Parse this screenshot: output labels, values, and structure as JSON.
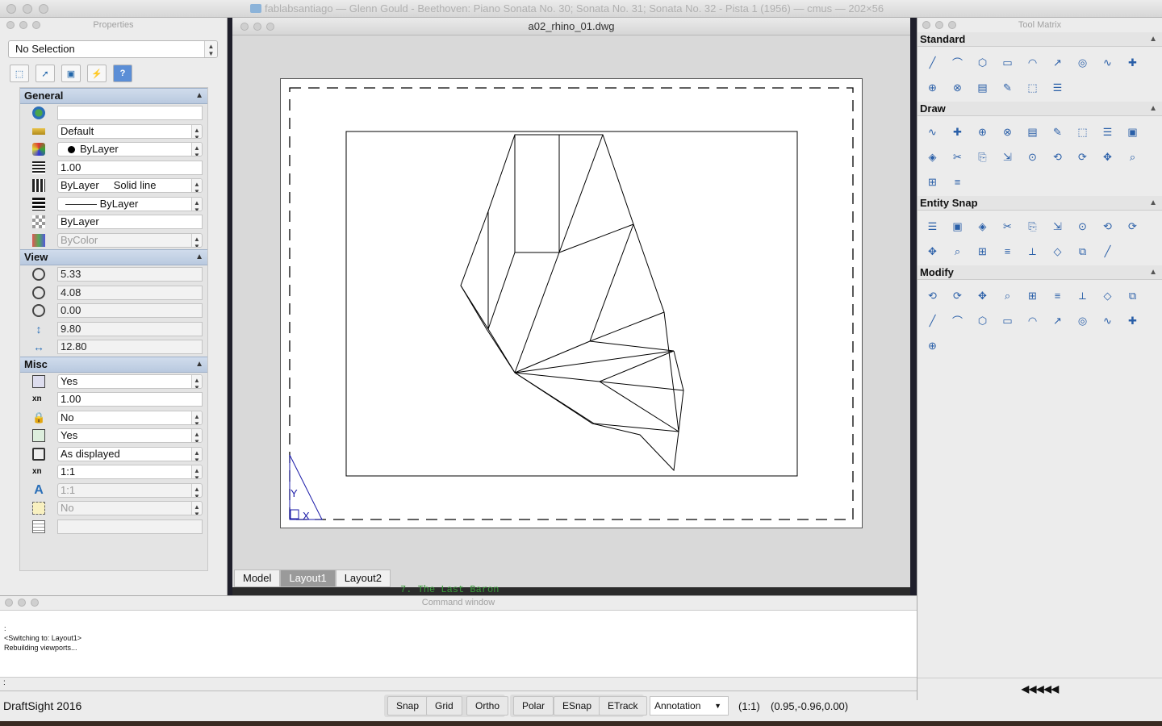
{
  "window": {
    "title": "fablabsantiago — Glenn Gould - Beethoven: Piano Sonata No. 30; Sonata No. 31; Sonata No. 32 - Pista 1 (1956) — cmus — 202×56"
  },
  "properties": {
    "panel_title": "Properties",
    "selection": "No Selection",
    "sections": {
      "general": {
        "title": "General",
        "rows": [
          {
            "icon": "globe-icon",
            "value": ""
          },
          {
            "icon": "layer-icon",
            "value": "Default"
          },
          {
            "icon": "color-icon",
            "value": "ByLayer"
          },
          {
            "icon": "linescale-icon",
            "value": "1.00"
          },
          {
            "icon": "linestyle-icon",
            "value": "ByLayer     Solid line"
          },
          {
            "icon": "lineweight-icon",
            "value": "——— ByLayer"
          },
          {
            "icon": "transparency-icon",
            "value": "ByLayer"
          },
          {
            "icon": "printstyle-icon",
            "value": "ByColor"
          }
        ]
      },
      "view": {
        "title": "View",
        "rows": [
          {
            "icon": "center-x-icon",
            "value": "5.33"
          },
          {
            "icon": "center-y-icon",
            "value": "4.08"
          },
          {
            "icon": "center-z-icon",
            "value": "0.00"
          },
          {
            "icon": "height-icon",
            "value": "9.80"
          },
          {
            "icon": "width-icon",
            "value": "12.80"
          }
        ]
      },
      "misc": {
        "title": "Misc",
        "rows": [
          {
            "icon": "ucs-icon",
            "value": "Yes"
          },
          {
            "icon": "scale-icon",
            "value": "1.00"
          },
          {
            "icon": "lock-icon",
            "value": "No"
          },
          {
            "icon": "ucs-origin-icon",
            "value": "Yes"
          },
          {
            "icon": "print-icon",
            "value": "As displayed"
          },
          {
            "icon": "xn-scale-icon",
            "value": "1:1"
          },
          {
            "icon": "annotation-icon",
            "value": "1:1"
          },
          {
            "icon": "annotative-icon",
            "value": "No"
          },
          {
            "icon": "table-icon",
            "value": ""
          }
        ]
      }
    }
  },
  "drawing": {
    "title": "a02_rhino_01.dwg",
    "tabs": [
      "Model",
      "Layout1",
      "Layout2"
    ],
    "active_tab": "Layout1",
    "ucs_labels": {
      "y": "Y",
      "x": "X"
    }
  },
  "background_text": "7. The Last Baron",
  "command": {
    "panel_title": "Command window",
    "lines": [
      ":",
      "<Switching to: Layout1>",
      "Rebuilding viewports..."
    ],
    "prompt": ":"
  },
  "status": {
    "app_name": "DraftSight 2016",
    "buttons": [
      "Snap",
      "Grid",
      "Ortho",
      "Polar",
      "ESnap",
      "ETrack"
    ],
    "annotation": "Annotation",
    "scale": "(1:1)",
    "coords": "(0.95,-0.96,0.00)"
  },
  "tool_matrix": {
    "panel_title": "Tool Matrix",
    "sections": [
      {
        "title": "Standard",
        "tools": [
          "new-icon",
          "open-icon",
          "save-icon",
          "print-icon",
          "preview-icon",
          "cut-icon",
          "copy-icon",
          "paste-icon",
          "format-painter-icon",
          "undo-icon",
          "redo-icon",
          "pan-icon",
          "zoom-icon",
          "zoom-previous-icon",
          "table-icon"
        ]
      },
      {
        "title": "Draw",
        "tools": [
          "line-icon",
          "infinite-line-icon",
          "polygon-icon",
          "rectangle-icon",
          "arc-icon",
          "arc-3pt-icon",
          "circle-icon",
          "spline-icon",
          "polyline-icon",
          "points-icon",
          "spline-fit-icon",
          "hatch-icon",
          "block-icon",
          "wipeout-icon",
          "note-icon",
          "simple-note-icon",
          "gradient-icon",
          "boundary-icon",
          "ellipse-icon",
          "cloud-icon"
        ]
      },
      {
        "title": "Entity Snap",
        "tools": [
          "endpoint-snap-icon",
          "midpoint-snap-icon",
          "intersection-snap-icon",
          "apparent-intersection-icon",
          "extension-snap-icon",
          "perpendicular-snap-icon",
          "tangent-snap-icon",
          "center-snap-icon",
          "quadrant-snap-icon",
          "nearest-snap-icon",
          "insertion-snap-icon",
          "node-snap-icon",
          "parallel-snap-icon",
          "clear-snap-icon",
          "snap-settings-icon",
          "snap-tracking-icon",
          "snap-options-icon"
        ]
      },
      {
        "title": "Modify",
        "tools": [
          "erase-icon",
          "copy-entity-icon",
          "mirror-icon",
          "offset-icon",
          "chamfer-fill-icon",
          "pattern-icon",
          "rotate-icon",
          "scale-entity-icon",
          "stretch-icon",
          "fillet-icon",
          "trim-icon",
          "extend-icon",
          "break-icon",
          "split-icon",
          "explode-icon",
          "edit-hatch-icon",
          "layer-icon",
          "properties-icon",
          "explode2-icon"
        ]
      }
    ],
    "footer": "◀◀◀◀◀"
  },
  "colors": {
    "accent": "#5b8ed6",
    "sheet_line": "#000000",
    "ucs": "#1a1aa8"
  }
}
